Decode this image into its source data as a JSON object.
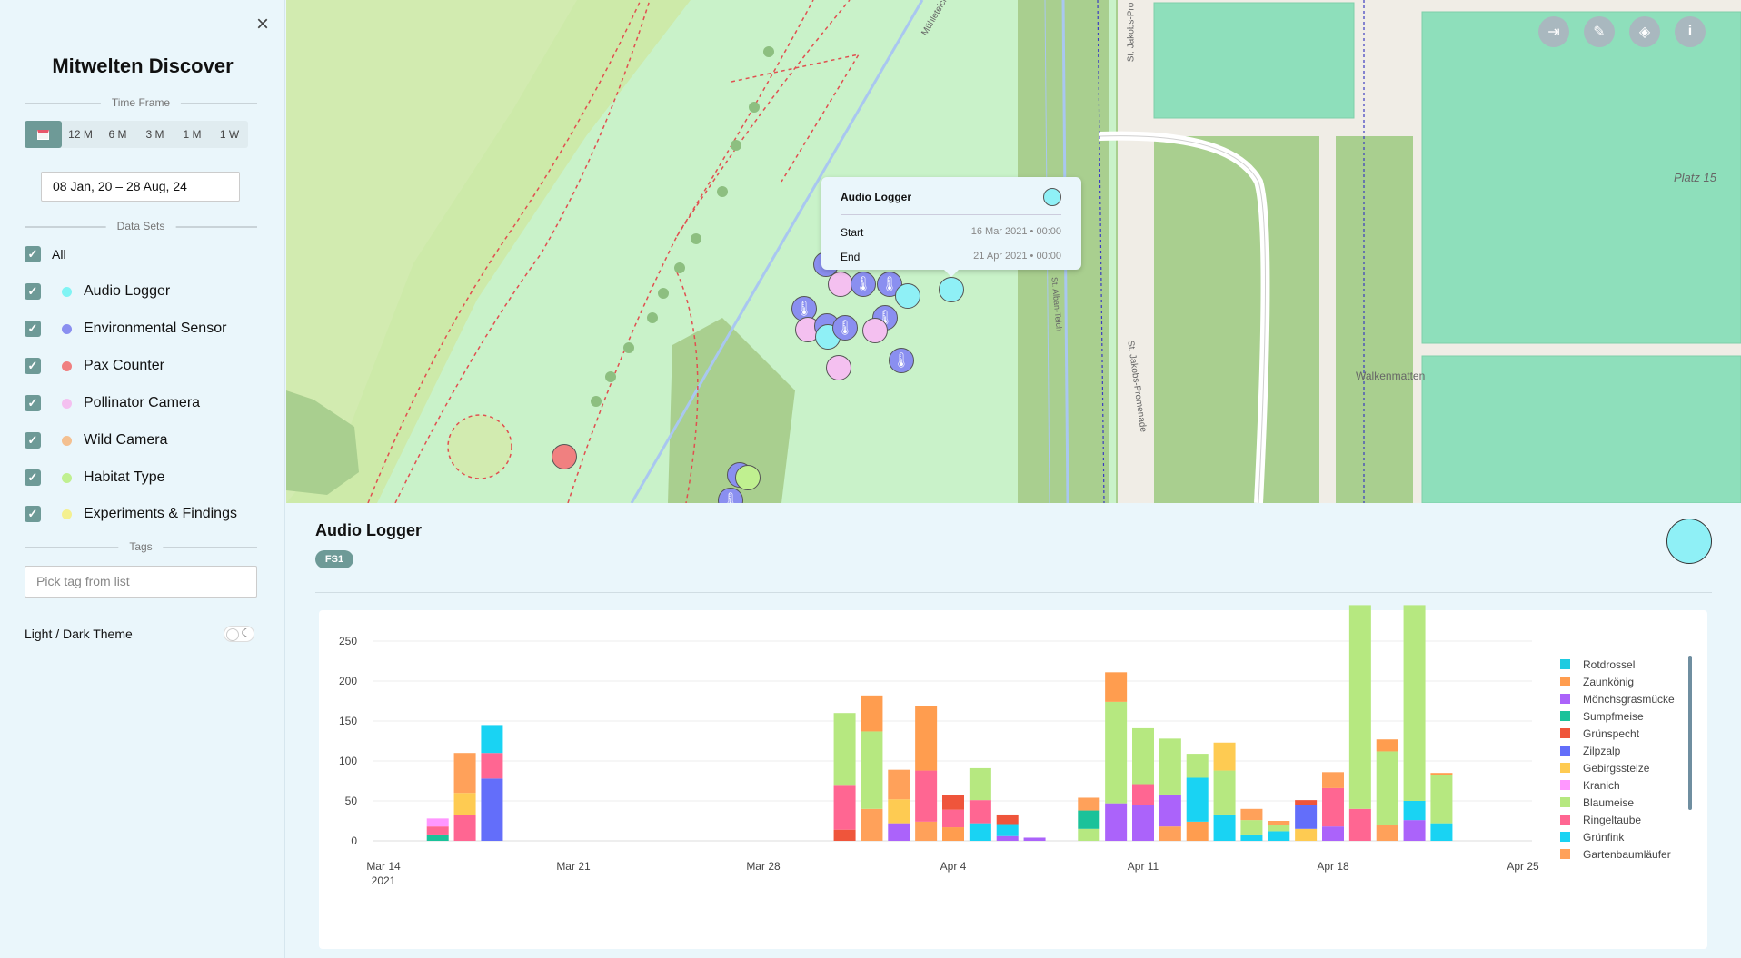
{
  "app": {
    "title": "Mitwelten Discover"
  },
  "sidebar": {
    "close_label": "×",
    "timeframe": {
      "heading": "Time Frame",
      "options": [
        "12 M",
        "6 M",
        "3 M",
        "1 M",
        "1 W"
      ],
      "selected": "calendar"
    },
    "date_range": "08 Jan, 20 – 28 Aug, 24",
    "datasets": {
      "heading": "Data Sets",
      "all_label": "All",
      "items": [
        {
          "label": "Audio Logger",
          "color": "#80f4f4",
          "checked": true
        },
        {
          "label": "Environmental Sensor",
          "color": "#8a8ff0",
          "checked": true
        },
        {
          "label": "Pax Counter",
          "color": "#f08080",
          "checked": true
        },
        {
          "label": "Pollinator Camera",
          "color": "#f4c0f0",
          "checked": true
        },
        {
          "label": "Wild Camera",
          "color": "#f4c090",
          "checked": true
        },
        {
          "label": "Habitat Type",
          "color": "#c0f090",
          "checked": true
        },
        {
          "label": "Experiments & Findings",
          "color": "#f4f090",
          "checked": true
        }
      ]
    },
    "tags": {
      "heading": "Tags",
      "placeholder": "Pick tag from list"
    },
    "theme": {
      "label": "Light / Dark Theme",
      "dark": false
    }
  },
  "map": {
    "labels": {
      "muhleteich": "Mühleteich",
      "st_jakobs_pro": "St. Jakobs-Pro",
      "st_jakobs_promenade": "St. Jakobs-Promenade",
      "st_alban_teich": "St. Alban-Teich",
      "platz": "Platz 15",
      "walkenmatten": "Walkenmatten"
    },
    "controls": [
      "login-icon",
      "comment-icon",
      "layers-icon",
      "info-icon"
    ],
    "popup": {
      "title": "Audio Logger",
      "start_label": "Start",
      "start_value": "16 Mar 2021 • 00:00",
      "end_label": "End",
      "end_value": "21 Apr 2021 • 00:00"
    }
  },
  "detail": {
    "title": "Audio Logger",
    "badge": "FS1"
  },
  "chart_data": {
    "type": "bar",
    "stacked": true,
    "x_tick_labels": [
      "Mar 14",
      "Mar 21",
      "Mar 28",
      "Apr 4",
      "Apr 11",
      "Apr 18",
      "Apr 25"
    ],
    "x_tick_sublabel": "2021",
    "y_ticks": [
      0,
      50,
      100,
      150,
      200,
      250
    ],
    "ylim": [
      0,
      300
    ],
    "legend_position": "right",
    "series": [
      {
        "name": "Rotdrossel",
        "color": "#1ecbe1"
      },
      {
        "name": "Zaunkönig",
        "color": "#ff9d4f"
      },
      {
        "name": "Mönchsgrasmücke",
        "color": "#ab63fa"
      },
      {
        "name": "Sumpfmeise",
        "color": "#1bc29a"
      },
      {
        "name": "Grünspecht",
        "color": "#ef553b"
      },
      {
        "name": "Zilpzalp",
        "color": "#636efa"
      },
      {
        "name": "Gebirgsstelze",
        "color": "#fecb52"
      },
      {
        "name": "Kranich",
        "color": "#ff97ff"
      },
      {
        "name": "Blaumeise",
        "color": "#b6e880"
      },
      {
        "name": "Ringeltaube",
        "color": "#ff6692"
      },
      {
        "name": "Grünfink",
        "color": "#19d3f3"
      },
      {
        "name": "Gartenbaumläufer",
        "color": "#ffa15a"
      }
    ],
    "bars": [
      {
        "x": "2021-03-16",
        "stack": [
          [
            "Sumpfmeise",
            8
          ],
          [
            "Ringeltaube",
            10
          ],
          [
            "Kranich",
            10
          ]
        ]
      },
      {
        "x": "2021-03-17",
        "stack": [
          [
            "Ringeltaube",
            32
          ],
          [
            "Gebirgsstelze",
            28
          ],
          [
            "Gartenbaumläufer",
            50
          ]
        ]
      },
      {
        "x": "2021-03-18",
        "stack": [
          [
            "Zilpzalp",
            78
          ],
          [
            "Ringeltaube",
            32
          ],
          [
            "Grünfink",
            35
          ]
        ]
      },
      {
        "x": "2021-03-31",
        "stack": [
          [
            "Grünspecht",
            14
          ],
          [
            "Ringeltaube",
            55
          ],
          [
            "Blaumeise",
            91
          ]
        ]
      },
      {
        "x": "2021-04-01",
        "stack": [
          [
            "Gartenbaumläufer",
            40
          ],
          [
            "Blaumeise",
            97
          ],
          [
            "Zaunkönig",
            45
          ]
        ]
      },
      {
        "x": "2021-04-02",
        "stack": [
          [
            "Mönchsgrasmücke",
            22
          ],
          [
            "Gebirgsstelze",
            30
          ],
          [
            "Gartenbaumläufer",
            37
          ]
        ]
      },
      {
        "x": "2021-04-03",
        "stack": [
          [
            "Gartenbaumläufer",
            24
          ],
          [
            "Ringeltaube",
            64
          ],
          [
            "Zaunkönig",
            81
          ]
        ]
      },
      {
        "x": "2021-04-04",
        "stack": [
          [
            "Zaunkönig",
            17
          ],
          [
            "Ringeltaube",
            22
          ],
          [
            "Grünspecht",
            18
          ]
        ]
      },
      {
        "x": "2021-04-05",
        "stack": [
          [
            "Grünfink",
            22
          ],
          [
            "Ringeltaube",
            29
          ],
          [
            "Blaumeise",
            40
          ]
        ]
      },
      {
        "x": "2021-04-06",
        "stack": [
          [
            "Mönchsgrasmücke",
            6
          ],
          [
            "Grünfink",
            15
          ],
          [
            "Grünspecht",
            12
          ]
        ]
      },
      {
        "x": "2021-04-07",
        "stack": [
          [
            "Mönchsgrasmücke",
            4
          ]
        ]
      },
      {
        "x": "2021-04-09",
        "stack": [
          [
            "Blaumeise",
            15
          ],
          [
            "Sumpfmeise",
            23
          ],
          [
            "Gartenbaumläufer",
            16
          ]
        ]
      },
      {
        "x": "2021-04-10",
        "stack": [
          [
            "Mönchsgrasmücke",
            47
          ],
          [
            "Blaumeise",
            127
          ],
          [
            "Zaunkönig",
            37
          ]
        ]
      },
      {
        "x": "2021-04-11",
        "stack": [
          [
            "Mönchsgrasmücke",
            45
          ],
          [
            "Ringeltaube",
            26
          ],
          [
            "Blaumeise",
            70
          ]
        ]
      },
      {
        "x": "2021-04-12",
        "stack": [
          [
            "Gartenbaumläufer",
            18
          ],
          [
            "Mönchsgrasmücke",
            40
          ],
          [
            "Blaumeise",
            70
          ]
        ]
      },
      {
        "x": "2021-04-13",
        "stack": [
          [
            "Zaunkönig",
            24
          ],
          [
            "Grünfink",
            55
          ],
          [
            "Blaumeise",
            30
          ]
        ]
      },
      {
        "x": "2021-04-14",
        "stack": [
          [
            "Grünfink",
            33
          ],
          [
            "Blaumeise",
            55
          ],
          [
            "Gebirgsstelze",
            35
          ]
        ]
      },
      {
        "x": "2021-04-15",
        "stack": [
          [
            "Grünfink",
            8
          ],
          [
            "Blaumeise",
            18
          ],
          [
            "Gartenbaumläufer",
            14
          ]
        ]
      },
      {
        "x": "2021-04-16",
        "stack": [
          [
            "Grünfink",
            12
          ],
          [
            "Blaumeise",
            8
          ],
          [
            "Gartenbaumläufer",
            5
          ]
        ]
      },
      {
        "x": "2021-04-17",
        "stack": [
          [
            "Gebirgsstelze",
            15
          ],
          [
            "Zilpzalp",
            30
          ],
          [
            "Grünspecht",
            6
          ]
        ]
      },
      {
        "x": "2021-04-18",
        "stack": [
          [
            "Mönchsgrasmücke",
            18
          ],
          [
            "Ringeltaube",
            48
          ],
          [
            "Gartenbaumläufer",
            20
          ]
        ]
      },
      {
        "x": "2021-04-19",
        "stack": [
          [
            "Ringeltaube",
            40
          ],
          [
            "Blaumeise",
            255
          ]
        ]
      },
      {
        "x": "2021-04-20",
        "stack": [
          [
            "Gartenbaumläufer",
            20
          ],
          [
            "Blaumeise",
            92
          ],
          [
            "Zaunkönig",
            15
          ]
        ]
      },
      {
        "x": "2021-04-21",
        "stack": [
          [
            "Mönchsgrasmücke",
            26
          ],
          [
            "Grünfink",
            24
          ],
          [
            "Blaumeise",
            245
          ]
        ]
      },
      {
        "x": "2021-04-22",
        "stack": [
          [
            "Grünfink",
            22
          ],
          [
            "Blaumeise",
            60
          ],
          [
            "Zaunkönig",
            3
          ]
        ]
      }
    ]
  }
}
